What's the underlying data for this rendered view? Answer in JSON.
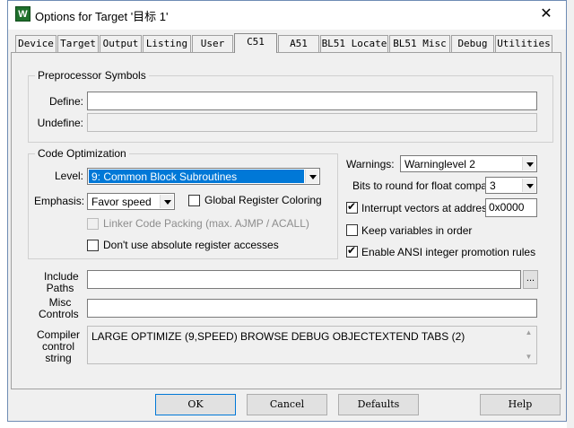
{
  "window": {
    "title": "Options for Target '目标 1'",
    "icon": "app-icon",
    "close_glyph": "✕"
  },
  "tabs": [
    {
      "label": "Device"
    },
    {
      "label": "Target"
    },
    {
      "label": "Output"
    },
    {
      "label": "Listing"
    },
    {
      "label": "User"
    },
    {
      "label": "C51",
      "active": true
    },
    {
      "label": "A51"
    },
    {
      "label": "BL51 Locate"
    },
    {
      "label": "BL51 Misc"
    },
    {
      "label": "Debug"
    },
    {
      "label": "Utilities"
    }
  ],
  "preprocessor": {
    "group_title": "Preprocessor Symbols",
    "define_label": "Define:",
    "define_value": "",
    "undefine_label": "Undefine:",
    "undefine_value": ""
  },
  "optimization": {
    "group_title": "Code Optimization",
    "level_label": "Level:",
    "level_value": "9: Common Block Subroutines",
    "emphasis_label": "Emphasis:",
    "emphasis_value": "Favor speed",
    "global_register_label": "Global Register Coloring",
    "linker_packing_label": "Linker Code Packing (max. AJMP / ACALL)",
    "no_absolute_label": "Don't use absolute register accesses"
  },
  "right_options": {
    "warnings_label": "Warnings:",
    "warnings_value": "Warninglevel 2",
    "bits_label": "Bits to round for float compare:",
    "bits_value": "3",
    "interrupt_label": "Interrupt vectors at address:",
    "interrupt_value": "0x0000",
    "interrupt_checked": true,
    "keep_vars_label": "Keep variables in order",
    "keep_vars_checked": false,
    "ansi_label": "Enable ANSI integer promotion rules",
    "ansi_checked": true
  },
  "paths": {
    "include_label_1": "Include",
    "include_label_2": "Paths",
    "include_value": "",
    "browse_label": "...",
    "misc_label_1": "Misc",
    "misc_label_2": "Controls",
    "misc_value": ""
  },
  "compiler": {
    "label_1": "Compiler",
    "label_2": "control",
    "label_3": "string",
    "value": "LARGE OPTIMIZE (9,SPEED) BROWSE DEBUG OBJECTEXTEND TABS (2)"
  },
  "buttons": {
    "ok": "OK",
    "cancel": "Cancel",
    "defaults": "Defaults",
    "help": "Help"
  },
  "colors": {
    "selection": "#0078d7",
    "dialog_bg": "#f0f0f0",
    "disabled_text": "#8d8d8d"
  }
}
